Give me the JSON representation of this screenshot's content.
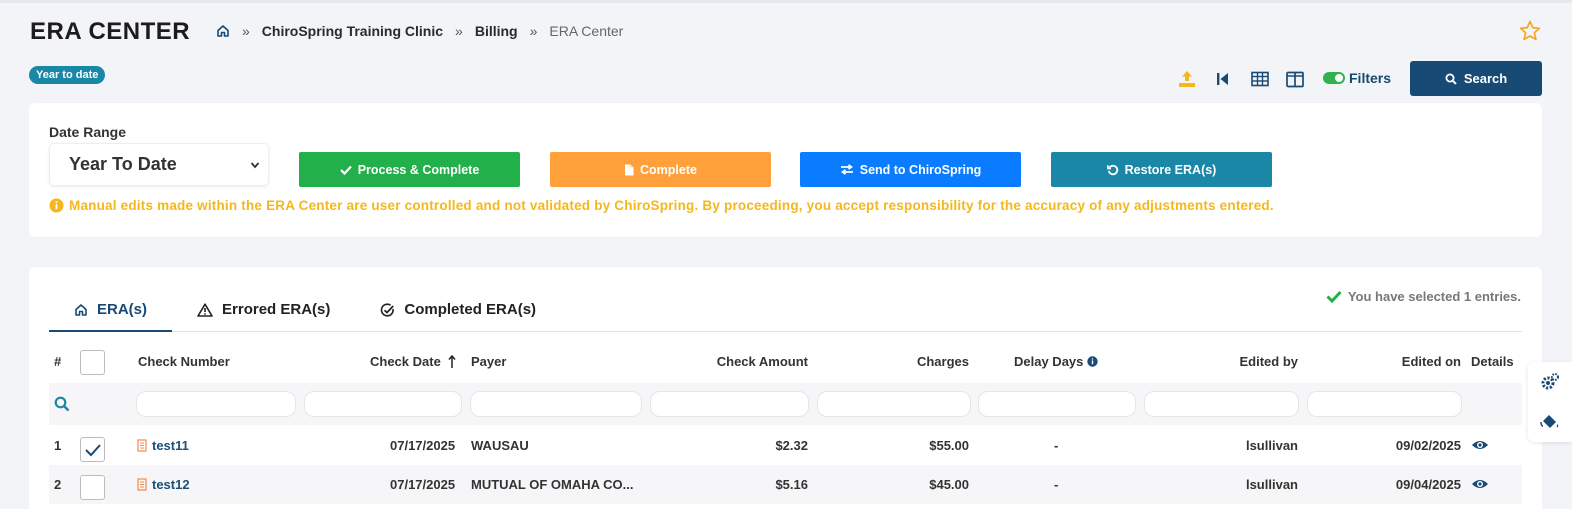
{
  "header": {
    "title": "ERA CENTER",
    "breadcrumb": [
      "ChiroSpring Training Clinic",
      "Billing",
      "ERA Center"
    ],
    "separator": "»",
    "badge": "Year to date"
  },
  "toolbar": {
    "filters_label": "Filters",
    "filters_on": true,
    "search_label": "Search"
  },
  "date_filter": {
    "label": "Date Range",
    "value": "Year To Date"
  },
  "actions": {
    "process_complete": "Process & Complete",
    "complete": "Complete",
    "send": "Send to ChiroSpring",
    "restore": "Restore ERA(s)"
  },
  "warning": "Manual edits made within the ERA Center are user controlled and not validated by ChiroSpring. By proceeding, you accept responsibility for the accuracy of any adjustments entered.",
  "tabs": [
    {
      "label": "ERA(s)",
      "active": true
    },
    {
      "label": "Errored ERA(s)",
      "active": false
    },
    {
      "label": "Completed ERA(s)",
      "active": false
    }
  ],
  "selection_message": "You have selected 1 entries.",
  "columns": {
    "num": "#",
    "check_number": "Check Number",
    "check_date": "Check Date",
    "payer": "Payer",
    "check_amount": "Check Amount",
    "charges": "Charges",
    "delay_days": "Delay Days",
    "edited_by": "Edited by",
    "edited_on": "Edited on",
    "details": "Details"
  },
  "rows": [
    {
      "num": "1",
      "checked": true,
      "check_number": "test11",
      "check_date": "07/17/2025",
      "payer": "WAUSAU",
      "check_amount": "$2.32",
      "charges": "$55.00",
      "delay_days": "-",
      "edited_by": "lsullivan",
      "edited_on": "09/02/2025"
    },
    {
      "num": "2",
      "checked": false,
      "check_number": "test12",
      "check_date": "07/17/2025",
      "payer": "MUTUAL OF OMAHA CO...",
      "check_amount": "$5.16",
      "charges": "$45.00",
      "delay_days": "-",
      "edited_by": "lsullivan",
      "edited_on": "09/04/2025"
    }
  ],
  "colors": {
    "primary": "#174a75",
    "green": "#22b04a",
    "orange": "#ffa03a",
    "blue": "#0a7cff",
    "teal": "#1a87a7",
    "warning": "#f5b71c"
  },
  "icons": {
    "home": "home-icon",
    "star": "star-icon",
    "upload": "upload-icon",
    "first_page": "skip-back-icon",
    "grid": "table-icon",
    "columns": "columns-icon",
    "search": "search-icon",
    "info": "info-icon",
    "eye": "eye-icon",
    "file": "file-icon",
    "gear": "gears-icon",
    "paint": "paint-bucket-icon"
  }
}
